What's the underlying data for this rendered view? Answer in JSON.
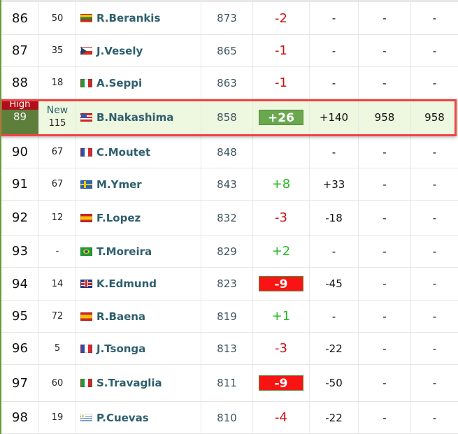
{
  "highlight": {
    "badge_label": "High",
    "prev_label": "New"
  },
  "rows": [
    {
      "rank": "86",
      "prev": "50",
      "flag": "lt",
      "name": "R.Berankis",
      "points": "873",
      "change": "-2",
      "change_style": "down",
      "d1": "-",
      "d2": "-",
      "d3": "-"
    },
    {
      "rank": "87",
      "prev": "35",
      "flag": "cz",
      "name": "J.Vesely",
      "points": "865",
      "change": "-1",
      "change_style": "down",
      "d1": "-",
      "d2": "-",
      "d3": "-"
    },
    {
      "rank": "88",
      "prev": "18",
      "flag": "it",
      "name": "A.Seppi",
      "points": "863",
      "change": "-1",
      "change_style": "down",
      "d1": "-",
      "d2": "-",
      "d3": "-"
    },
    {
      "rank": "89",
      "prev": "115",
      "flag": "us",
      "name": "B.Nakashima",
      "points": "858",
      "change": "+26",
      "change_style": "box-pos",
      "d1": "+140",
      "d2": "958",
      "d3": "958",
      "highlighted": true
    },
    {
      "rank": "90",
      "prev": "67",
      "flag": "fr",
      "name": "C.Moutet",
      "points": "848",
      "change": "",
      "change_style": "none",
      "d1": "-",
      "d2": "-",
      "d3": "-"
    },
    {
      "rank": "91",
      "prev": "67",
      "flag": "se",
      "name": "M.Ymer",
      "points": "843",
      "change": "+8",
      "change_style": "up",
      "d1": "+33",
      "d2": "-",
      "d3": "-"
    },
    {
      "rank": "92",
      "prev": "12",
      "flag": "es",
      "name": "F.Lopez",
      "points": "832",
      "change": "-3",
      "change_style": "down",
      "d1": "-18",
      "d2": "-",
      "d3": "-"
    },
    {
      "rank": "93",
      "prev": "-",
      "flag": "br",
      "name": "T.Moreira",
      "points": "829",
      "change": "+2",
      "change_style": "up",
      "d1": "-",
      "d2": "-",
      "d3": "-"
    },
    {
      "rank": "94",
      "prev": "14",
      "flag": "gb",
      "name": "K.Edmund",
      "points": "823",
      "change": "-9",
      "change_style": "box-neg",
      "d1": "-45",
      "d2": "-",
      "d3": "-"
    },
    {
      "rank": "95",
      "prev": "72",
      "flag": "es",
      "name": "R.Baena",
      "points": "819",
      "change": "+1",
      "change_style": "up",
      "d1": "-",
      "d2": "-",
      "d3": "-"
    },
    {
      "rank": "96",
      "prev": "5",
      "flag": "fr",
      "name": "J.Tsonga",
      "points": "813",
      "change": "-3",
      "change_style": "down",
      "d1": "-22",
      "d2": "-",
      "d3": "-"
    },
    {
      "rank": "97",
      "prev": "60",
      "flag": "it",
      "name": "S.Travaglia",
      "points": "811",
      "change": "-9",
      "change_style": "box-neg",
      "d1": "-50",
      "d2": "-",
      "d3": "-"
    },
    {
      "rank": "98",
      "prev": "19",
      "flag": "uy",
      "name": "P.Cuevas",
      "points": "810",
      "change": "-4",
      "change_style": "down",
      "d1": "-22",
      "d2": "-",
      "d3": "-"
    }
  ],
  "colors": {
    "highlight_frame": "#f04444",
    "highlight_bg": "#eef7df",
    "positive": "#22bb22",
    "negative": "#cc1111",
    "box_negative": "#f91414",
    "box_positive": "#6aa84f",
    "name_text": "#2e5f6e"
  }
}
